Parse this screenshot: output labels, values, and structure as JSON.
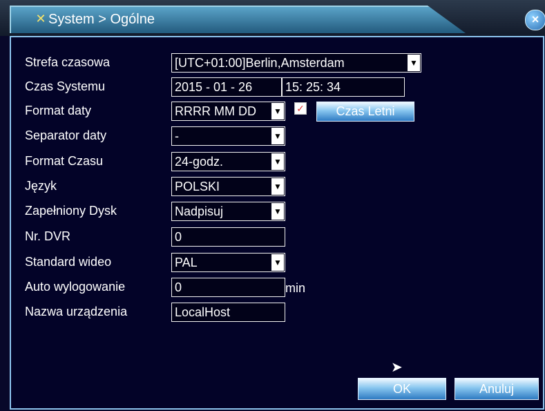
{
  "window": {
    "title": "System > Ogólne",
    "title_icon": "tools-icon",
    "close_icon": "close-icon"
  },
  "settings": [
    {
      "label": "Strefa czasowa",
      "value": "[UTC+01:00]Berlin,Amsterdam",
      "type": "dropdown"
    },
    {
      "label": "Czas Systemu",
      "value_date": "2015 - 01 - 26",
      "value_time": "15: 25: 34",
      "type": "datetime"
    },
    {
      "label": "Format daty",
      "value": "RRRR MM DD",
      "type": "dropdown"
    },
    {
      "label": "Separator daty",
      "value": "-",
      "type": "dropdown"
    },
    {
      "label": "Format Czasu",
      "value": "24-godz.",
      "type": "dropdown"
    },
    {
      "label": "Język",
      "value": "POLSKI",
      "type": "dropdown"
    },
    {
      "label": "Zapełniony Dysk",
      "value": "Nadpisuj",
      "type": "dropdown"
    },
    {
      "label": "Nr. DVR",
      "value": "0",
      "type": "input"
    },
    {
      "label": "Standard wideo",
      "value": "PAL",
      "type": "dropdown"
    },
    {
      "label": "Auto wylogowanie",
      "value": "0",
      "unit": "min",
      "type": "input"
    },
    {
      "label": "Nazwa urządzenia",
      "value": "LocalHost",
      "type": "input"
    }
  ],
  "daylight_saving": {
    "checked": true,
    "button_label": "Czas Letni"
  },
  "buttons": {
    "ok": "OK",
    "cancel": "Anuluj"
  },
  "colors": {
    "panel_background": "#030328",
    "title_gradient_top": "#5aa3c8",
    "title_gradient_bottom": "#20577a",
    "button_blue": "#2f7bc2"
  }
}
